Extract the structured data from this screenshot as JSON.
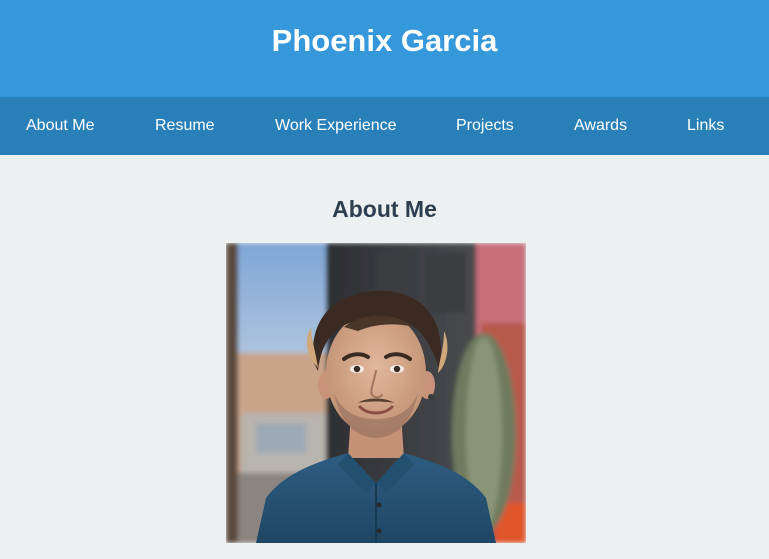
{
  "header": {
    "title": "Phoenix Garcia"
  },
  "nav": {
    "items": [
      {
        "label": "About Me"
      },
      {
        "label": "Resume"
      },
      {
        "label": "Work Experience"
      },
      {
        "label": "Projects"
      },
      {
        "label": "Awards"
      },
      {
        "label": "Links"
      }
    ]
  },
  "main": {
    "section_title": "About Me",
    "photo": {
      "alt": "Portrait of Phoenix Garcia"
    }
  },
  "colors": {
    "header_bg": "#3498db",
    "nav_bg": "#2980b9",
    "page_bg": "#ecf0f1",
    "heading_text": "#2c3e50"
  }
}
